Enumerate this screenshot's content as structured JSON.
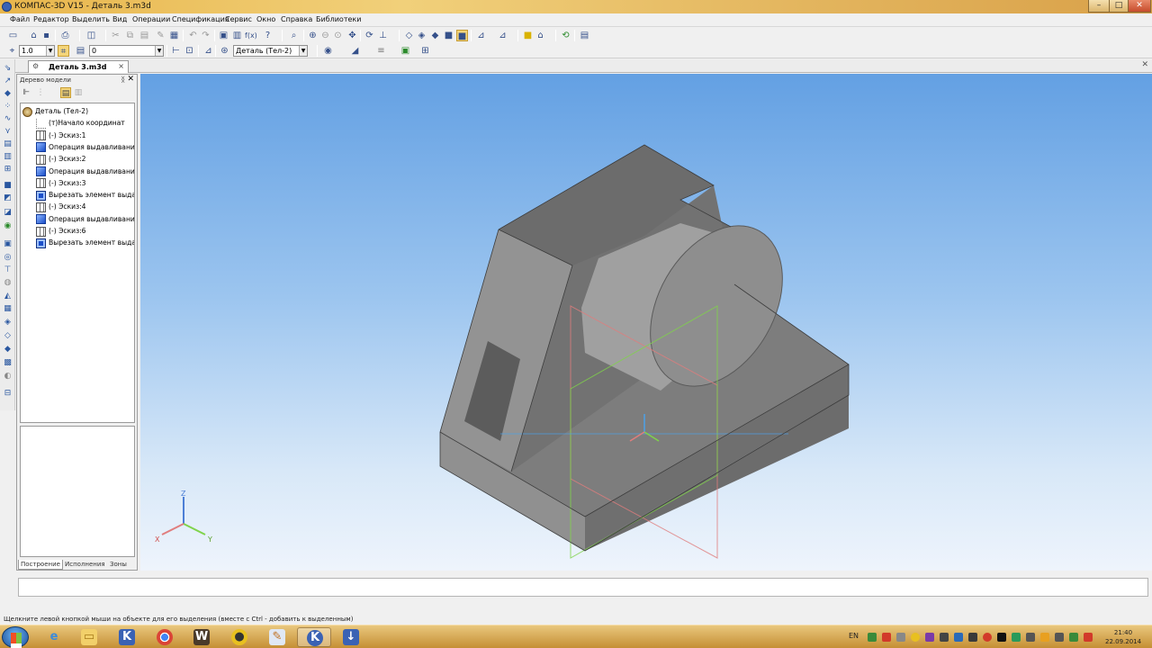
{
  "window": {
    "title": "КОМПАС-3D V15 - Деталь 3.m3d",
    "min_label": "–",
    "max_label": "□",
    "close_label": "✕"
  },
  "menu": [
    "Файл",
    "Редактор",
    "Выделить",
    "Вид",
    "Операции",
    "Спецификация",
    "Сервис",
    "Окно",
    "Справка",
    "Библиотеки"
  ],
  "toolbar2": {
    "scale_value": "1.0",
    "layer_value": "0",
    "part_value": "Деталь (Тел-2)"
  },
  "document_tab": {
    "label": "Деталь 3.m3d",
    "close": "×"
  },
  "model_tree": {
    "header": "Дерево модели",
    "pin": "ᛝ",
    "close": "✕",
    "items": [
      {
        "label": "Деталь (Тел-2)",
        "icon": "part-icon",
        "depth": 0
      },
      {
        "label": "(т)Начало координат",
        "icon": "origin-icon",
        "depth": 1
      },
      {
        "label": "(-) Эскиз:1",
        "icon": "sketch-icon",
        "depth": 1
      },
      {
        "label": "Операция выдавливания",
        "icon": "extrude-icon",
        "depth": 1
      },
      {
        "label": "(-) Эскиз:2",
        "icon": "sketch-icon",
        "depth": 1
      },
      {
        "label": "Операция выдавливания",
        "icon": "extrude-icon",
        "depth": 1
      },
      {
        "label": "(-) Эскиз:3",
        "icon": "sketch-icon",
        "depth": 1
      },
      {
        "label": "Вырезать элемент выдав.",
        "icon": "cut-icon",
        "depth": 1
      },
      {
        "label": "(-) Эскиз:4",
        "icon": "sketch-icon",
        "depth": 1
      },
      {
        "label": "Операция выдавливания",
        "icon": "extrude-icon",
        "depth": 1
      },
      {
        "label": "(-) Эскиз:6",
        "icon": "sketch-icon",
        "depth": 1
      },
      {
        "label": "Вырезать элемент выдав.",
        "icon": "cut-icon",
        "depth": 1
      }
    ],
    "tabs": [
      "Построение",
      "Исполнения",
      "Зоны"
    ],
    "active_tab": "Построение"
  },
  "viewport": {
    "axis_labels": {
      "x": "X",
      "y": "Y",
      "z": "Z"
    },
    "background_top": "#63a0e3",
    "background_bottom": "#eef4fc",
    "model_color": "#8c8c8c"
  },
  "status": {
    "message": "Щелкните левой кнопкой мыши на объекте для его выделения (вместе с Ctrl - добавить к выделенным)"
  },
  "taskbar": {
    "language": "EN",
    "time": "21:40",
    "date": "22.09.2014",
    "apps": [
      "internet-explorer",
      "file-explorer",
      "kompas-word",
      "chrome",
      "world-of-tanks",
      "yellow-app",
      "paint-app",
      "kompas-3d",
      "installer-app"
    ]
  }
}
